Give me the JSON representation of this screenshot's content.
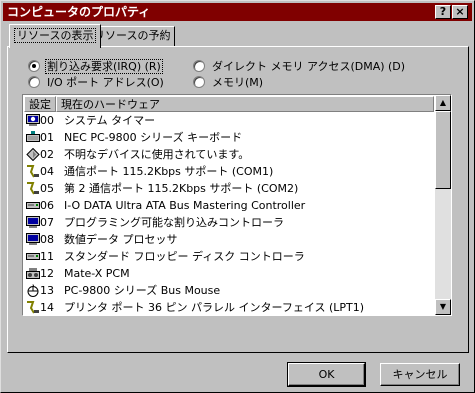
{
  "window": {
    "title": "コンピュータのプロパティ",
    "help_label": "?",
    "close_label": "×"
  },
  "tabs": [
    {
      "label": "リソースの表示"
    },
    {
      "label": "リソースの予約"
    }
  ],
  "radio_options": [
    {
      "label": "割り込み要求(IRQ) (R)",
      "checked": true
    },
    {
      "label": "I/O ポート アドレス(O)",
      "checked": false
    },
    {
      "label": "ダイレクト メモリ アクセス(DMA) (D)",
      "checked": false
    },
    {
      "label": "メモリ(M)",
      "checked": false
    }
  ],
  "list": {
    "headers": [
      "設定",
      "現在のハードウェア"
    ],
    "rows": [
      {
        "setting": "00",
        "name": "システム タイマー",
        "icon": "system-timer-icon"
      },
      {
        "setting": "01",
        "name": "NEC PC-9800 シリーズ キーボード",
        "icon": "keyboard-icon"
      },
      {
        "setting": "02",
        "name": "不明なデバイスに使用されています。",
        "icon": "unknown-device-icon"
      },
      {
        "setting": "04",
        "name": "通信ポート 115.2Kbps サポート (COM1)",
        "icon": "comm-port-icon"
      },
      {
        "setting": "05",
        "name": "第 2 通信ポート 115.2Kbps サポート (COM2)",
        "icon": "comm-port-icon"
      },
      {
        "setting": "06",
        "name": "I-O DATA Ultra ATA Bus Mastering Controller",
        "icon": "disk-controller-icon"
      },
      {
        "setting": "07",
        "name": "プログラミング可能な割り込みコントローラ",
        "icon": "system-device-icon"
      },
      {
        "setting": "08",
        "name": "数値データ プロセッサ",
        "icon": "system-device-icon"
      },
      {
        "setting": "11",
        "name": "スタンダード フロッピー ディスク コントローラ",
        "icon": "disk-controller-icon"
      },
      {
        "setting": "12",
        "name": "Mate-X PCM",
        "icon": "sound-device-icon"
      },
      {
        "setting": "13",
        "name": "PC-9800 シリーズ Bus Mouse",
        "icon": "mouse-icon"
      },
      {
        "setting": "14",
        "name": "プリンタ ポート 36 ピン パラレル インターフェイス (LPT1)",
        "icon": "printer-port-icon"
      }
    ]
  },
  "buttons": {
    "ok": "OK",
    "cancel": "キャンセル"
  },
  "colors": {
    "title_bar": "#800000",
    "face": "#c0c0c0"
  }
}
